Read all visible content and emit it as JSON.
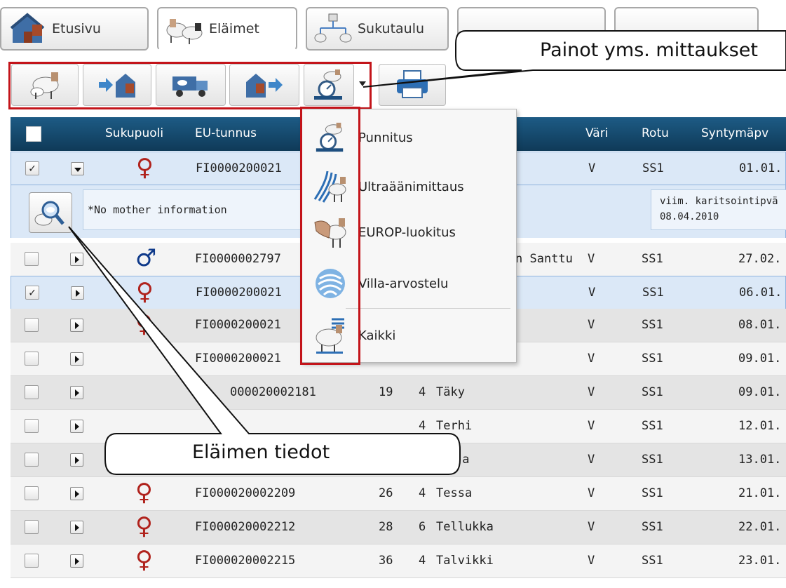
{
  "tabs": [
    {
      "label": "Etusivu",
      "icon": "barn-icon"
    },
    {
      "label": "Eläimet",
      "icon": "sheep-pair-icon"
    },
    {
      "label": "Sukutaulu",
      "icon": "pedigree-icon"
    },
    {
      "label": "",
      "icon": "hidden-tab-icon"
    },
    {
      "label": "",
      "icon": "hidden-tab-icon"
    }
  ],
  "toolbar": {
    "buttons": [
      "sheep-with-lamb-icon",
      "arrival-barn-icon",
      "truck-icon",
      "departure-barn-icon",
      "scale-icon",
      "print-icon"
    ]
  },
  "table": {
    "headers": {
      "sukupuoli": "Sukupuoli",
      "eu": "EU-tunnus",
      "vari": "Väri",
      "rotu": "Rotu",
      "synty": "Syntymäpv"
    },
    "rows": [
      {
        "checked": "✓",
        "sex": "♀",
        "eu": "FI0000200021",
        "num": "",
        "pk": "",
        "name": "",
        "vari": "V",
        "rotu": "SS1",
        "date": "01.01."
      },
      {
        "checked": "",
        "sex": "♂",
        "eu": "FI0000002797",
        "num": "",
        "pk": "",
        "name": "n Santtu",
        "vari": "V",
        "rotu": "SS1",
        "date": "27.02."
      },
      {
        "checked": "✓",
        "sex": "♀",
        "eu": "FI0000200021",
        "num": "",
        "pk": "",
        "name": "",
        "vari": "V",
        "rotu": "SS1",
        "date": "06.01."
      },
      {
        "checked": "",
        "sex": "♀",
        "eu": "FI0000200021",
        "num": "",
        "pk": "",
        "name": "",
        "vari": "V",
        "rotu": "SS1",
        "date": "08.01."
      },
      {
        "checked": "",
        "sex": "",
        "eu": "FI0000200021",
        "num": "",
        "pk": "",
        "name": "",
        "vari": "V",
        "rotu": "SS1",
        "date": "09.01."
      },
      {
        "checked": "",
        "sex": "",
        "eu": "000020002181",
        "num": "19",
        "pk": "4",
        "name": "Täky",
        "vari": "V",
        "rotu": "SS1",
        "date": "09.01."
      },
      {
        "checked": "",
        "sex": "",
        "eu": "",
        "num": "",
        "pk": "4",
        "name": "Terhi",
        "vari": "V",
        "rotu": "SS1",
        "date": "12.01."
      },
      {
        "checked": "",
        "sex": "",
        "eu": "",
        "num": "",
        "pk": "",
        "name": "ja",
        "vari": "V",
        "rotu": "SS1",
        "date": "13.01."
      },
      {
        "checked": "",
        "sex": "♀",
        "eu": "FI000020002209",
        "num": "26",
        "pk": "4",
        "name": "Tessa",
        "vari": "V",
        "rotu": "SS1",
        "date": "21.01."
      },
      {
        "checked": "",
        "sex": "♀",
        "eu": "FI000020002212",
        "num": "28",
        "pk": "6",
        "name": "Tellukka",
        "vari": "V",
        "rotu": "SS1",
        "date": "22.01."
      },
      {
        "checked": "",
        "sex": "♀",
        "eu": "FI000020002215",
        "num": "36",
        "pk": "4",
        "name": "Talvikki",
        "vari": "V",
        "rotu": "SS1",
        "date": "23.01."
      }
    ]
  },
  "detail": {
    "mother": "*No mother information",
    "lambing_label": "viim. karitsointipvä",
    "lambing_date": "08.04.2010"
  },
  "menu": {
    "items": [
      {
        "label": "Punnitus",
        "icon": "scale-icon"
      },
      {
        "label": "Ultraäänimittaus",
        "icon": "ultrasound-icon"
      },
      {
        "label": "EUROP-luokitus",
        "icon": "hand-grading-icon"
      },
      {
        "label": "Villa-arvostelu",
        "icon": "wool-icon"
      },
      {
        "label": "Kaikki",
        "icon": "all-measurements-icon"
      }
    ]
  },
  "callouts": {
    "top": "Painot yms. mittaukset",
    "bottom": "Eläimen tiedot"
  }
}
